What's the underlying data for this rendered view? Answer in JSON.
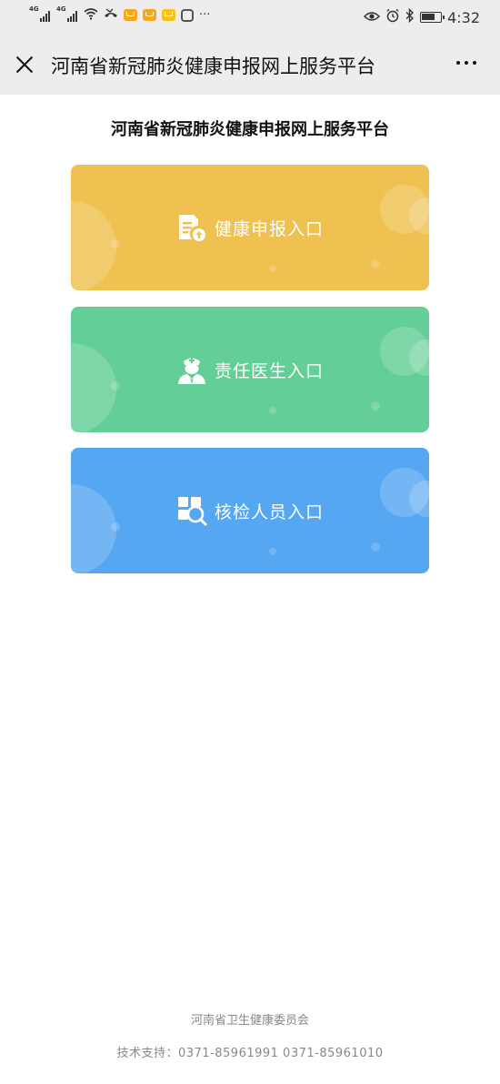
{
  "status_bar": {
    "network_1": "4G",
    "network_2": "4G",
    "more": "···",
    "time": "4:32"
  },
  "title_bar": {
    "title": "河南省新冠肺炎健康申报网上服务平台"
  },
  "main": {
    "page_title": "河南省新冠肺炎健康申报网上服务平台",
    "entries": [
      {
        "label": "健康申报入口",
        "icon": "health-report-icon",
        "color": "#EEC150"
      },
      {
        "label": "责任医生入口",
        "icon": "doctor-icon",
        "color": "#63CF96"
      },
      {
        "label": "核检人员入口",
        "icon": "inspector-search-icon",
        "color": "#56A7F2"
      }
    ]
  },
  "footer": {
    "organization": "河南省卫生健康委员会",
    "support": "技术支持：0371-85961991  0371-85961010"
  }
}
